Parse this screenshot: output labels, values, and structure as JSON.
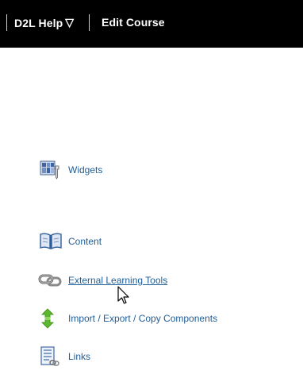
{
  "navbar": {
    "help_label": "D2L Help",
    "help_caret": "▽",
    "edit_course_label": "Edit Course"
  },
  "tools": {
    "widgets": "Widgets",
    "content": "Content",
    "external_learning_tools": "External Learning Tools",
    "import_export": "Import / Export / Copy Components",
    "links": "Links"
  },
  "colors": {
    "navbar_bg": "#000000",
    "link": "#1f5d96"
  },
  "icons": [
    "widgets-icon",
    "book-icon",
    "chain-link-icon",
    "green-arrows-icon",
    "links-list-icon",
    "mouse-pointer-icon"
  ]
}
